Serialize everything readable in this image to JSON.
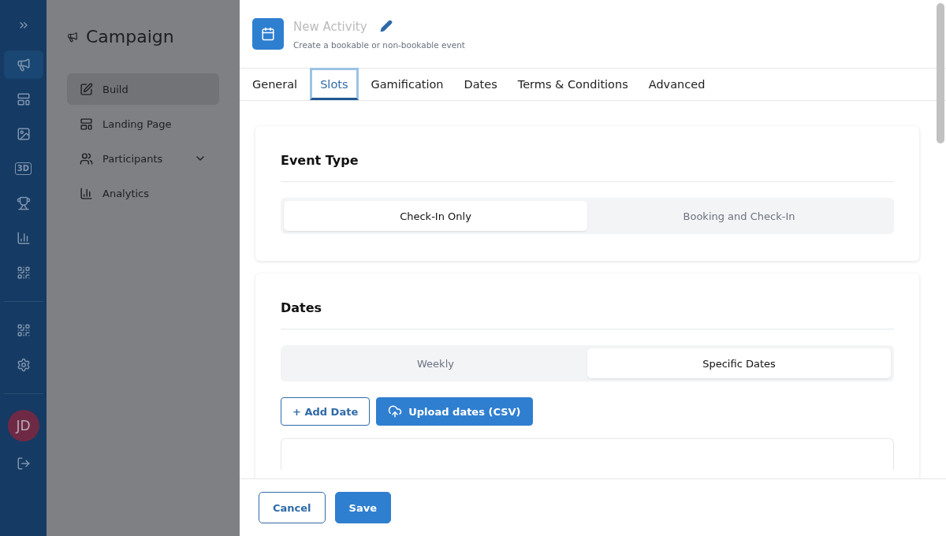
{
  "rail": {
    "items": [
      {
        "kind": "icon",
        "selected": true
      },
      {
        "kind": "icon",
        "selected": false
      },
      {
        "kind": "icon",
        "selected": false
      },
      {
        "kind": "text",
        "label": "3D",
        "selected": false
      },
      {
        "kind": "icon",
        "selected": false
      },
      {
        "kind": "icon",
        "selected": false
      },
      {
        "kind": "icon",
        "selected": false
      }
    ],
    "avatar": {
      "initials": "JD"
    }
  },
  "sidebar": {
    "title": "Campaign",
    "items": [
      {
        "label": "Build",
        "selected": true
      },
      {
        "label": "Landing Page",
        "selected": false
      },
      {
        "label": "Participants",
        "selected": false,
        "expanded": false
      },
      {
        "label": "Analytics",
        "selected": false
      }
    ]
  },
  "drawer": {
    "title_placeholder": "New Activity",
    "subtitle": "Create a bookable or non-bookable event",
    "tabs": [
      {
        "label": "General",
        "selected": false
      },
      {
        "label": "Slots",
        "selected": true
      },
      {
        "label": "Gamification",
        "selected": false
      },
      {
        "label": "Dates",
        "selected": false
      },
      {
        "label": "Terms & Conditions",
        "selected": false
      },
      {
        "label": "Advanced",
        "selected": false
      }
    ],
    "sections": [
      {
        "title": "Event Type",
        "options": [
          {
            "label": "Check-In Only",
            "selected": true
          },
          {
            "label": "Booking and Check-In",
            "selected": false
          }
        ]
      },
      {
        "title": "Dates",
        "options": [
          {
            "label": "Weekly",
            "selected": false
          },
          {
            "label": "Specific Dates",
            "selected": true
          }
        ],
        "buttons": [
          {
            "label": "+ Add Date",
            "kind": "outline"
          },
          {
            "label": "Upload dates (CSV)",
            "kind": "upload"
          }
        ]
      }
    ],
    "footer_buttons": [
      {
        "label": "Cancel",
        "kind": "outline"
      },
      {
        "label": "Save",
        "kind": "primary"
      }
    ]
  }
}
